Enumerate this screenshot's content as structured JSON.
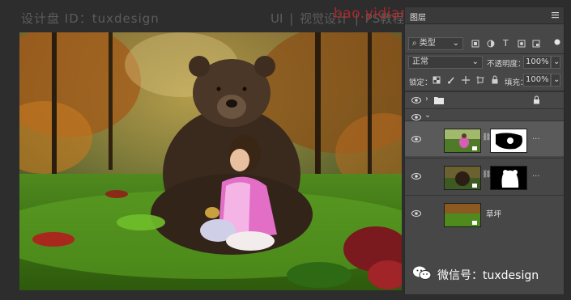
{
  "watermark": {
    "designer": "设计盘 ID：tuxdesign",
    "categories": [
      "UI",
      "视觉设计",
      "PS教程"
    ],
    "site_url": "bao.yidianshei.com",
    "wechat": "微信号：tuxdesign"
  },
  "layers_panel": {
    "tab_title": "图层",
    "filter_label": "类型",
    "blend_mode": "正常",
    "opacity_label": "不透明度：",
    "opacity_value": "100%",
    "lock_label": "锁定：",
    "fill_label": "填充：",
    "fill_value": "100%",
    "layers": [
      {
        "kind": "group",
        "name": ""
      },
      {
        "kind": "group-open",
        "name": ""
      },
      {
        "kind": "smart-object-masked",
        "name": "",
        "more": "...",
        "selected": true
      },
      {
        "kind": "smart-object-masked",
        "name": "",
        "more": "..."
      },
      {
        "kind": "smart-object",
        "name": "草坪"
      }
    ]
  },
  "colors": {
    "panel_bg": "#474747",
    "selected_layer": "#5a5a5a",
    "watermark_red": "#c0282c"
  }
}
